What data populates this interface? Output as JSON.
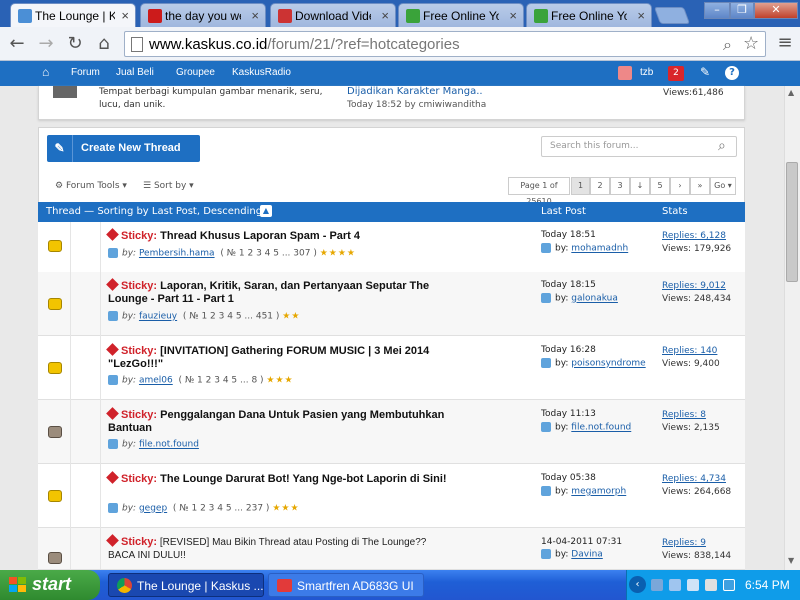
{
  "browser": {
    "tabs": [
      {
        "title": "The Lounge | Kaskus",
        "active": true,
        "favicon_color": "#4b8fd6"
      },
      {
        "title": "the day you went away",
        "active": false,
        "favicon_color": "#cc1b1b"
      },
      {
        "title": "Download Video",
        "active": false,
        "favicon_color": "#cc3333"
      },
      {
        "title": "Free Online YouTube",
        "active": false,
        "favicon_color": "#3aa33a"
      },
      {
        "title": "Free Online YouTube",
        "active": false,
        "favicon_color": "#3aa33a"
      }
    ],
    "url_host": "www.kaskus.co.id",
    "url_path": "/forum/21/?ref=hotcategories"
  },
  "site_nav": {
    "items": [
      "Forum",
      "Jual Beli",
      "Groupee",
      "KaskusRadio"
    ],
    "username": "tzb",
    "notification_count": "2"
  },
  "forum_header": {
    "description": "Tempat berbagi kumpulan gambar menarik, seru, lucu, dan unik.",
    "last_thread_title": "Dijadikan Karakter Manga..",
    "last_thread_meta": "Today 18:52 by cmiwiwanditha",
    "views": "Views:61,486"
  },
  "toolbar": {
    "create_button": "Create New Thread",
    "search_placeholder": "Search this forum...",
    "forum_tools": "Forum Tools",
    "sort_by": "Sort by",
    "page_label": "Page 1 of 25610",
    "pages": [
      "1",
      "2",
      "3",
      "↓",
      "5",
      "›",
      "»"
    ],
    "go_label": "Go"
  },
  "table_header": {
    "thread": "Thread — Sorting by Last Post, Descending",
    "last_post": "Last Post",
    "stats": "Stats"
  },
  "threads": [
    {
      "sticky": "Sticky:",
      "title": "Thread Khusus Laporan Spam - Part 4",
      "by": "by:",
      "author": "Pembersih.hama",
      "pages": "( № 1 2 3 4 5 ... 307 )",
      "stars": "★★★★",
      "last_time": "Today 18:51",
      "last_by": "by:",
      "last_user": "mohamadnh",
      "replies": "Replies: 6,128",
      "views": "Views: 179,926",
      "icon": "yellow"
    },
    {
      "sticky": "Sticky:",
      "title": "Laporan, Kritik, Saran, dan Pertanyaan Seputar The Lounge - Part 11 - Part 1",
      "by": "by:",
      "author": "fauzieuy",
      "pages": "( № 1 2 3 4 5 ... 451 )",
      "stars": "★★",
      "last_time": "Today 18:15",
      "last_by": "by:",
      "last_user": "galonakua",
      "replies": "Replies: 9,012",
      "views": "Views: 248,434",
      "icon": "yellow"
    },
    {
      "sticky": "Sticky:",
      "title": "[INVITATION] Gathering FORUM MUSIC | 3 Mei 2014 \"LezGo!!!\"",
      "by": "by:",
      "author": "amel06",
      "pages": "( № 1 2 3 4 5 ... 8 )",
      "stars": "★★★",
      "last_time": "Today 16:28",
      "last_by": "by:",
      "last_user": "poisonsyndrome",
      "replies": "Replies: 140",
      "views": "Views: 9,400",
      "icon": "yellow"
    },
    {
      "sticky": "Sticky:",
      "title": "Penggalangan Dana Untuk Pasien yang Membutuhkan Bantuan",
      "by": "by:",
      "author": "file.not.found",
      "pages": "",
      "stars": "",
      "last_time": "Today 11:13",
      "last_by": "by:",
      "last_user": "file.not.found",
      "replies": "Replies: 8",
      "views": "Views: 2,135",
      "icon": "grey"
    },
    {
      "sticky": "Sticky:",
      "title": "The Lounge Darurat Bot! Yang Nge-bot Laporin di Sini!",
      "by": "by:",
      "author": "gegep",
      "pages": "( № 1 2 3 4 5 ... 237 )",
      "stars": "★★★",
      "last_time": "Today 05:38",
      "last_by": "by:",
      "last_user": "megamorph",
      "replies": "Replies: 4,734",
      "views": "Views: 264,668",
      "icon": "yellow"
    },
    {
      "sticky": "Sticky:",
      "title": "[REVISED] Mau Bikin Thread atau Posting di The Lounge?? BACA INI DULU!!",
      "by": "",
      "author": "",
      "pages": "",
      "stars": "",
      "last_time": "14-04-2011 07:31",
      "last_by": "by:",
      "last_user": "Davina",
      "replies": "Replies: 9",
      "views": "Views: 838,144",
      "icon": "grey"
    }
  ],
  "taskbar": {
    "start": "start",
    "tasks": [
      "The Lounge | Kaskus ...",
      "Smartfren AD683G UI"
    ],
    "clock": "6:54 PM"
  }
}
